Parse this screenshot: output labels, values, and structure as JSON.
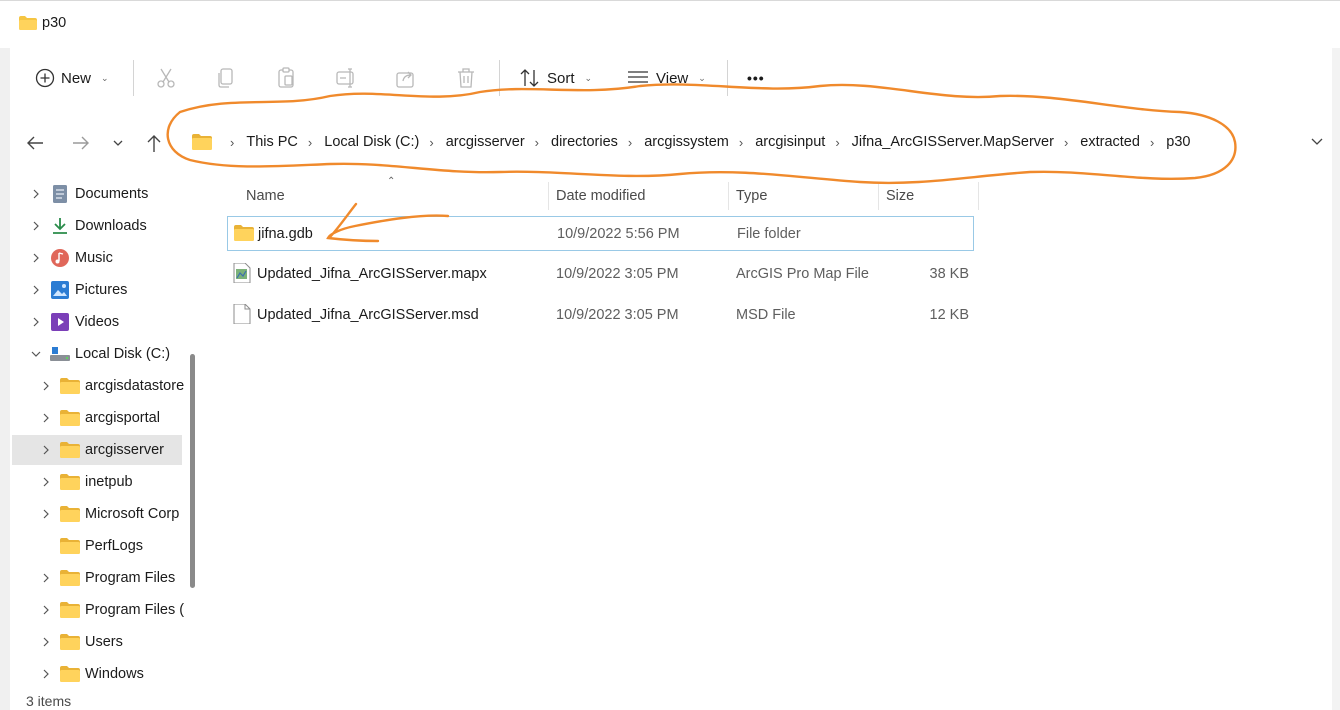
{
  "window": {
    "title": "p30"
  },
  "commandbar": {
    "new_label": "New",
    "sort_label": "Sort",
    "view_label": "View",
    "more_label": "•••"
  },
  "navigation": {
    "breadcrumb": [
      "This PC",
      "Local Disk (C:)",
      "arcgisserver",
      "directories",
      "arcgissystem",
      "arcgisinput",
      "Jifna_ArcGISServer.MapServer",
      "extracted",
      "p30"
    ]
  },
  "sidebar": {
    "items": [
      {
        "label": "Documents",
        "icon": "documents-icon"
      },
      {
        "label": "Downloads",
        "icon": "downloads-icon"
      },
      {
        "label": "Music",
        "icon": "music-icon"
      },
      {
        "label": "Pictures",
        "icon": "pictures-icon"
      },
      {
        "label": "Videos",
        "icon": "videos-icon"
      },
      {
        "label": "Local Disk (C:)",
        "icon": "drive-icon"
      },
      {
        "label": "arcgisdatastore",
        "icon": "folder-icon"
      },
      {
        "label": "arcgisportal",
        "icon": "folder-icon"
      },
      {
        "label": "arcgisserver",
        "icon": "folder-icon"
      },
      {
        "label": "inetpub",
        "icon": "folder-icon"
      },
      {
        "label": "Microsoft Corp",
        "icon": "folder-icon"
      },
      {
        "label": "PerfLogs",
        "icon": "folder-icon"
      },
      {
        "label": "Program Files",
        "icon": "folder-icon"
      },
      {
        "label": "Program Files (",
        "icon": "folder-icon"
      },
      {
        "label": "Users",
        "icon": "folder-icon"
      },
      {
        "label": "Windows",
        "icon": "folder-icon"
      }
    ]
  },
  "file_list": {
    "columns": [
      "Name",
      "Date modified",
      "Type",
      "Size"
    ],
    "rows": [
      {
        "name": "jifna.gdb",
        "date": "10/9/2022 5:56 PM",
        "type": "File folder",
        "size": ""
      },
      {
        "name": "Updated_Jifna_ArcGISServer.mapx",
        "date": "10/9/2022 3:05 PM",
        "type": "ArcGIS Pro Map File",
        "size": "38 KB"
      },
      {
        "name": "Updated_Jifna_ArcGISServer.msd",
        "date": "10/9/2022 3:05 PM",
        "type": "MSD File",
        "size": "12 KB"
      }
    ]
  },
  "status": {
    "item_count": "3 items"
  },
  "colors": {
    "folder": "#f5c542",
    "annotation": "#f08a2c",
    "selection": "#e5e5e5",
    "focus_border": "#99c9e6"
  }
}
